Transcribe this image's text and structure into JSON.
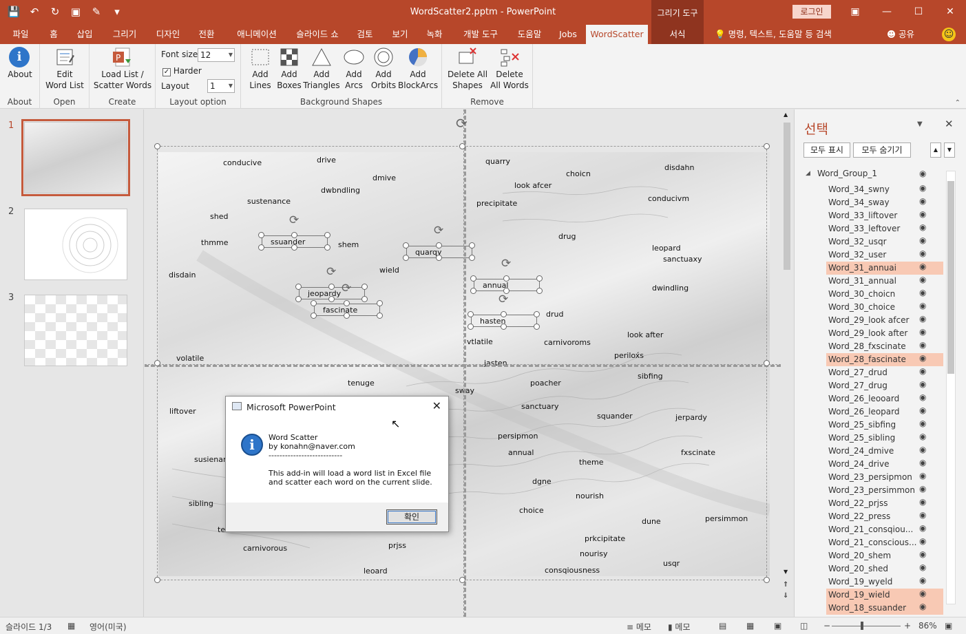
{
  "window": {
    "doc_title": "WordScatter2.pptm - PowerPoint",
    "context_group": "그리기 도구",
    "login": "로그인"
  },
  "tabs": [
    "파일",
    "홈",
    "삽입",
    "그리기",
    "디자인",
    "전환",
    "애니메이션",
    "슬라이드 쇼",
    "검토",
    "보기",
    "녹화",
    "개발 도구",
    "도움말",
    "Jobs",
    "WordScatter",
    "서식"
  ],
  "tellme": "명령, 텍스트, 도움말 등 검색",
  "share": "공유",
  "ribbon": {
    "about": {
      "btn": "About",
      "group": "About"
    },
    "open": {
      "btn1": "Edit",
      "btn2": "Word List",
      "group": "Open"
    },
    "create": {
      "btn1": "Load List /",
      "btn2": "Scatter Words",
      "group": "Create"
    },
    "layout": {
      "font_size_label": "Font size",
      "font_size": "12",
      "harder": "Harder",
      "layout_label": "Layout",
      "layout": "1",
      "group": "Layout option"
    },
    "bg": {
      "lines": [
        "Add",
        "Lines"
      ],
      "boxes": [
        "Add",
        "Boxes"
      ],
      "triangles": [
        "Add",
        "Triangles"
      ],
      "arcs": [
        "Add",
        "Arcs"
      ],
      "orbits": [
        "Add",
        "Orbits"
      ],
      "blockarcs": [
        "Add",
        "BlockArcs"
      ],
      "group": "Background Shapes"
    },
    "remove": {
      "shapes": [
        "Delete All",
        "Shapes"
      ],
      "words": [
        "Delete",
        "All Words"
      ],
      "group": "Remove"
    }
  },
  "slides": [
    "1",
    "2",
    "3"
  ],
  "words": [
    [
      "conducive",
      94,
      9
    ],
    [
      "drive",
      230,
      5
    ],
    [
      "quarry",
      475,
      7
    ],
    [
      "dmive",
      311,
      31
    ],
    [
      "choicn",
      592,
      25
    ],
    [
      "disdahn",
      735,
      16
    ],
    [
      "dwbndling",
      236,
      49
    ],
    [
      "look afcer",
      517,
      42
    ],
    [
      "sustenance",
      129,
      65
    ],
    [
      "precipitate",
      462,
      68
    ],
    [
      "conducivm",
      711,
      61
    ],
    [
      "shed",
      75,
      87
    ],
    [
      "thmme",
      62,
      125
    ],
    [
      "shem",
      261,
      128
    ],
    [
      "drug",
      581,
      116
    ],
    [
      "leopard",
      717,
      133
    ],
    [
      "sanctuaxy",
      733,
      149
    ],
    [
      "disdain",
      15,
      172
    ],
    [
      "dwindling",
      717,
      191
    ],
    [
      "wield",
      321,
      165
    ],
    [
      "drud",
      563,
      229
    ],
    [
      "vtlatile",
      448,
      269
    ],
    [
      "carnivoroms",
      560,
      270
    ],
    [
      "look after",
      681,
      259
    ],
    [
      "perilox́s",
      662,
      289
    ],
    [
      "volatile",
      26,
      293
    ],
    [
      "jasten",
      473,
      300
    ],
    [
      "sibfing",
      696,
      319
    ],
    [
      "tenuge",
      275,
      329
    ],
    [
      "poacher",
      540,
      329
    ],
    [
      "sway",
      431,
      340
    ],
    [
      "sanctuary",
      527,
      363
    ],
    [
      "liftover",
      16,
      370
    ],
    [
      "squander",
      637,
      377
    ],
    [
      "jerpardy",
      751,
      379
    ],
    [
      "persipmon",
      493,
      406
    ],
    [
      "annual",
      508,
      430
    ],
    [
      "theme",
      611,
      444
    ],
    [
      "fxscinate",
      759,
      430
    ],
    [
      "susienance",
      52,
      440
    ],
    [
      "dgne",
      543,
      472
    ],
    [
      "nourish",
      606,
      493
    ],
    [
      "sibling",
      44,
      504
    ],
    [
      "choice",
      524,
      514
    ],
    [
      "dune",
      702,
      530
    ],
    [
      "persimmon",
      794,
      526
    ],
    [
      "teruce",
      86,
      542
    ],
    [
      "prkcipitate",
      619,
      555
    ],
    [
      "carnivorous",
      123,
      569
    ],
    [
      "prjss",
      334,
      565
    ],
    [
      "nourisy",
      612,
      577
    ],
    [
      "usqr",
      733,
      591
    ],
    [
      "leoard",
      298,
      602
    ],
    [
      "consqiousness",
      561,
      601
    ]
  ],
  "selected_words": [
    [
      "ssuander",
      162,
      129
    ],
    [
      "quarqy",
      372,
      144
    ],
    [
      "annual",
      470,
      192
    ],
    [
      "jeopardy",
      216,
      204
    ],
    [
      "fascinate",
      238,
      228
    ],
    [
      "hasten",
      466,
      244
    ]
  ],
  "selection_pane": {
    "title": "선택",
    "show_all": "모두 표시",
    "hide_all": "모두 숨기기",
    "group": "Word_Group_1",
    "items": [
      {
        "n": "Word_34_swny",
        "h": false
      },
      {
        "n": "Word_34_sway",
        "h": false
      },
      {
        "n": "Word_33_liftover",
        "h": false
      },
      {
        "n": "Word_33_leftover",
        "h": false
      },
      {
        "n": "Word_32_usqr",
        "h": false
      },
      {
        "n": "Word_32_user",
        "h": false
      },
      {
        "n": "Word_31_annuai",
        "h": true
      },
      {
        "n": "Word_31_annual",
        "h": false
      },
      {
        "n": "Word_30_choicn",
        "h": false
      },
      {
        "n": "Word_30_choice",
        "h": false
      },
      {
        "n": "Word_29_look afcer",
        "h": false
      },
      {
        "n": "Word_29_look after",
        "h": false
      },
      {
        "n": "Word_28_fxscinate",
        "h": false
      },
      {
        "n": "Word_28_fascinate",
        "h": true
      },
      {
        "n": "Word_27_drud",
        "h": false
      },
      {
        "n": "Word_27_drug",
        "h": false
      },
      {
        "n": "Word_26_leooard",
        "h": false
      },
      {
        "n": "Word_26_leopard",
        "h": false
      },
      {
        "n": "Word_25_sibfing",
        "h": false
      },
      {
        "n": "Word_25_sibling",
        "h": false
      },
      {
        "n": "Word_24_dmive",
        "h": false
      },
      {
        "n": "Word_24_drive",
        "h": false
      },
      {
        "n": "Word_23_persipmon",
        "h": false
      },
      {
        "n": "Word_23_persimmon",
        "h": false
      },
      {
        "n": "Word_22_prjss",
        "h": false
      },
      {
        "n": "Word_22_press",
        "h": false
      },
      {
        "n": "Word_21_consqiou...",
        "h": false
      },
      {
        "n": "Word_21_conscious...",
        "h": false
      },
      {
        "n": "Word_20_shem",
        "h": false
      },
      {
        "n": "Word_20_shed",
        "h": false
      },
      {
        "n": "Word_19_wyeld",
        "h": false
      },
      {
        "n": "Word_19_wield",
        "h": true
      },
      {
        "n": "Word_18_ssuander",
        "h": true
      }
    ]
  },
  "dialog": {
    "title": "Microsoft PowerPoint",
    "line1": "Word Scatter",
    "line2": "by konahn@naver.com",
    "line3": "---------------------------",
    "line4": "This add-in will load a word list in Excel file",
    "line5": "and scatter each word on the current slide.",
    "ok": "확인"
  },
  "status": {
    "slide": "슬라이드 1/3",
    "lang": "영어(미국)",
    "notes": "메모",
    "comments": "메모",
    "zoom": "86%"
  },
  "colors": {
    "accent": "#b7472a",
    "highlight": "#f8c9b4"
  }
}
